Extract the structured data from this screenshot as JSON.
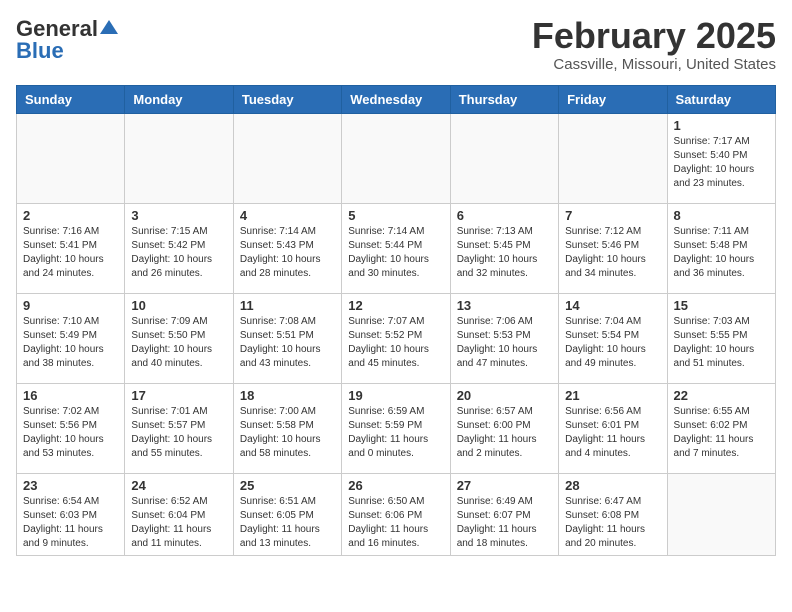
{
  "header": {
    "logo_general": "General",
    "logo_blue": "Blue",
    "title": "February 2025",
    "location": "Cassville, Missouri, United States"
  },
  "weekdays": [
    "Sunday",
    "Monday",
    "Tuesday",
    "Wednesday",
    "Thursday",
    "Friday",
    "Saturday"
  ],
  "weeks": [
    [
      {
        "day": "",
        "info": ""
      },
      {
        "day": "",
        "info": ""
      },
      {
        "day": "",
        "info": ""
      },
      {
        "day": "",
        "info": ""
      },
      {
        "day": "",
        "info": ""
      },
      {
        "day": "",
        "info": ""
      },
      {
        "day": "1",
        "info": "Sunrise: 7:17 AM\nSunset: 5:40 PM\nDaylight: 10 hours and 23 minutes."
      }
    ],
    [
      {
        "day": "2",
        "info": "Sunrise: 7:16 AM\nSunset: 5:41 PM\nDaylight: 10 hours and 24 minutes."
      },
      {
        "day": "3",
        "info": "Sunrise: 7:15 AM\nSunset: 5:42 PM\nDaylight: 10 hours and 26 minutes."
      },
      {
        "day": "4",
        "info": "Sunrise: 7:14 AM\nSunset: 5:43 PM\nDaylight: 10 hours and 28 minutes."
      },
      {
        "day": "5",
        "info": "Sunrise: 7:14 AM\nSunset: 5:44 PM\nDaylight: 10 hours and 30 minutes."
      },
      {
        "day": "6",
        "info": "Sunrise: 7:13 AM\nSunset: 5:45 PM\nDaylight: 10 hours and 32 minutes."
      },
      {
        "day": "7",
        "info": "Sunrise: 7:12 AM\nSunset: 5:46 PM\nDaylight: 10 hours and 34 minutes."
      },
      {
        "day": "8",
        "info": "Sunrise: 7:11 AM\nSunset: 5:48 PM\nDaylight: 10 hours and 36 minutes."
      }
    ],
    [
      {
        "day": "9",
        "info": "Sunrise: 7:10 AM\nSunset: 5:49 PM\nDaylight: 10 hours and 38 minutes."
      },
      {
        "day": "10",
        "info": "Sunrise: 7:09 AM\nSunset: 5:50 PM\nDaylight: 10 hours and 40 minutes."
      },
      {
        "day": "11",
        "info": "Sunrise: 7:08 AM\nSunset: 5:51 PM\nDaylight: 10 hours and 43 minutes."
      },
      {
        "day": "12",
        "info": "Sunrise: 7:07 AM\nSunset: 5:52 PM\nDaylight: 10 hours and 45 minutes."
      },
      {
        "day": "13",
        "info": "Sunrise: 7:06 AM\nSunset: 5:53 PM\nDaylight: 10 hours and 47 minutes."
      },
      {
        "day": "14",
        "info": "Sunrise: 7:04 AM\nSunset: 5:54 PM\nDaylight: 10 hours and 49 minutes."
      },
      {
        "day": "15",
        "info": "Sunrise: 7:03 AM\nSunset: 5:55 PM\nDaylight: 10 hours and 51 minutes."
      }
    ],
    [
      {
        "day": "16",
        "info": "Sunrise: 7:02 AM\nSunset: 5:56 PM\nDaylight: 10 hours and 53 minutes."
      },
      {
        "day": "17",
        "info": "Sunrise: 7:01 AM\nSunset: 5:57 PM\nDaylight: 10 hours and 55 minutes."
      },
      {
        "day": "18",
        "info": "Sunrise: 7:00 AM\nSunset: 5:58 PM\nDaylight: 10 hours and 58 minutes."
      },
      {
        "day": "19",
        "info": "Sunrise: 6:59 AM\nSunset: 5:59 PM\nDaylight: 11 hours and 0 minutes."
      },
      {
        "day": "20",
        "info": "Sunrise: 6:57 AM\nSunset: 6:00 PM\nDaylight: 11 hours and 2 minutes."
      },
      {
        "day": "21",
        "info": "Sunrise: 6:56 AM\nSunset: 6:01 PM\nDaylight: 11 hours and 4 minutes."
      },
      {
        "day": "22",
        "info": "Sunrise: 6:55 AM\nSunset: 6:02 PM\nDaylight: 11 hours and 7 minutes."
      }
    ],
    [
      {
        "day": "23",
        "info": "Sunrise: 6:54 AM\nSunset: 6:03 PM\nDaylight: 11 hours and 9 minutes."
      },
      {
        "day": "24",
        "info": "Sunrise: 6:52 AM\nSunset: 6:04 PM\nDaylight: 11 hours and 11 minutes."
      },
      {
        "day": "25",
        "info": "Sunrise: 6:51 AM\nSunset: 6:05 PM\nDaylight: 11 hours and 13 minutes."
      },
      {
        "day": "26",
        "info": "Sunrise: 6:50 AM\nSunset: 6:06 PM\nDaylight: 11 hours and 16 minutes."
      },
      {
        "day": "27",
        "info": "Sunrise: 6:49 AM\nSunset: 6:07 PM\nDaylight: 11 hours and 18 minutes."
      },
      {
        "day": "28",
        "info": "Sunrise: 6:47 AM\nSunset: 6:08 PM\nDaylight: 11 hours and 20 minutes."
      },
      {
        "day": "",
        "info": ""
      }
    ]
  ]
}
